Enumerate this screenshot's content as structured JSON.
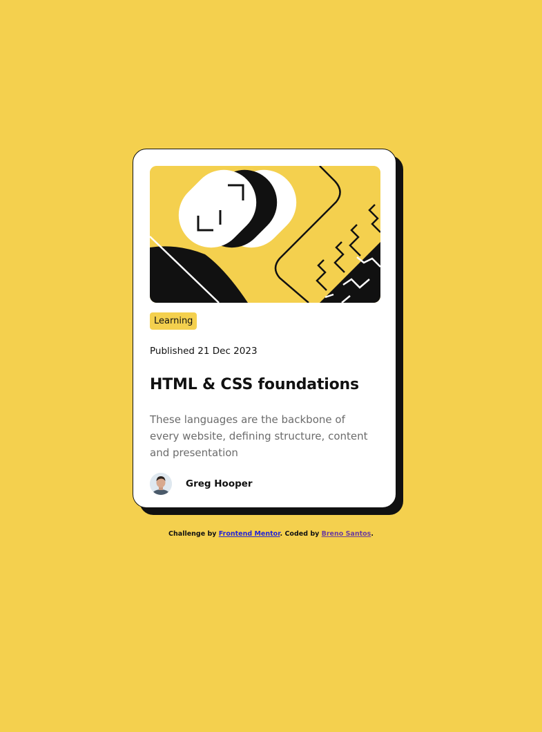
{
  "card": {
    "badge": "Learning",
    "published": "Published 21 Dec 2023",
    "title": "HTML & CSS foundations",
    "description": "These languages are the backbone of every website, defining structure, content and presentation",
    "author": "Greg Hooper"
  },
  "attribution": {
    "prefix": "Challenge by ",
    "link1": "Frontend Mentor",
    "middle": ". Coded by ",
    "link2": "Breno Santos",
    "suffix": "."
  },
  "colors": {
    "background": "#F4D04E",
    "card": "#FFFFFF",
    "text": "#111111",
    "muted": "#6B6B6B"
  },
  "icons": {
    "hero": "abstract-illustration",
    "avatar": "author-avatar"
  }
}
